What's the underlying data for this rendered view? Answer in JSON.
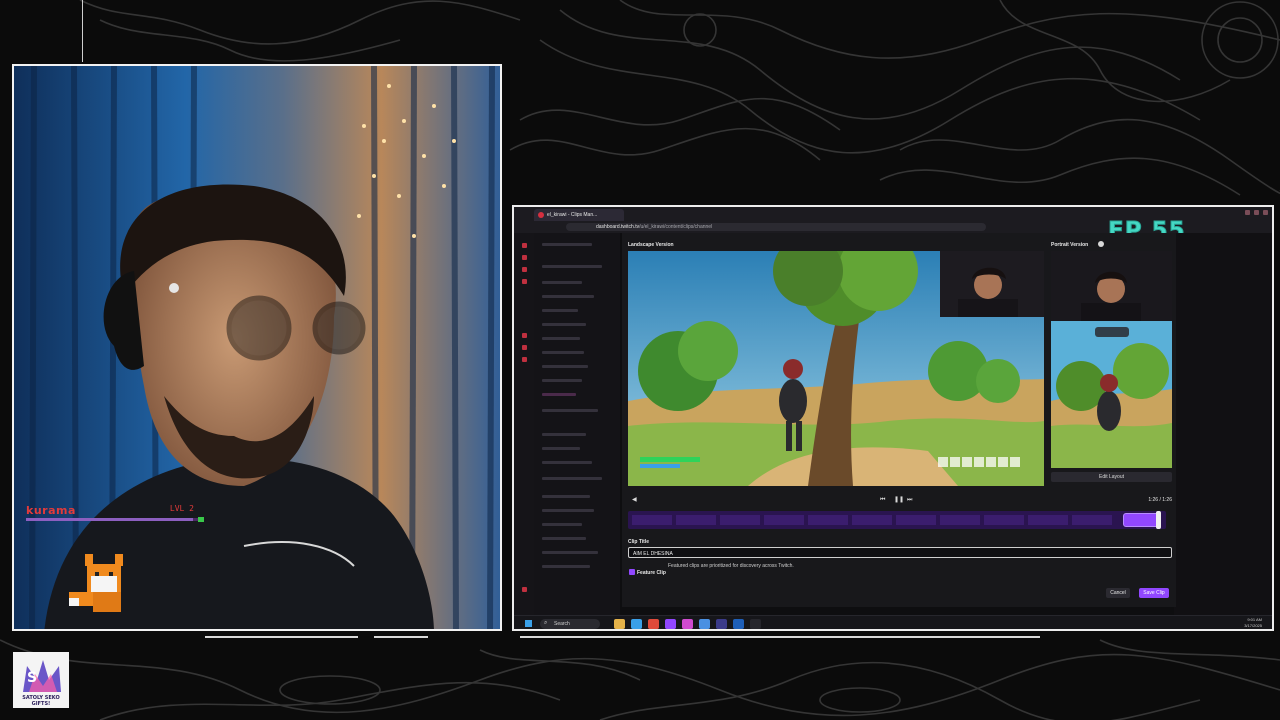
{
  "overlay": {
    "streamer_name": "kurama",
    "level_label": "LVL 2",
    "level_progress": 0.97,
    "episode_badge": "EP 55",
    "logo_text": "SATOLY SEKO GIFTS!"
  },
  "browser": {
    "tab_title": "el_kirawi - Clips Man...",
    "url_host": "dashboard.twitch.tv",
    "url_path": "/u/el_kirawi/content/clips/channel"
  },
  "clip_editor": {
    "landscape_label": "Landscape Version",
    "portrait_label": "Portrait Version",
    "edit_layout_label": "Edit Layout",
    "time_display": "1:26 / 1:26",
    "clip_title_label": "Clip Title",
    "clip_title_value": "AIM EL DHESINA",
    "feature_clip_label": "Feature Clip",
    "feature_clip_checked": true,
    "feature_description": "Featured clips are prioritized for discovery across Twitch.",
    "cancel_label": "Cancel",
    "save_label": "Save Clip",
    "timeline_selection": [
      0.92,
      0.99
    ]
  },
  "taskbar": {
    "search_placeholder": "Search",
    "clock_time": "9:01 AM",
    "clock_date": "3/17/2025"
  },
  "colors": {
    "accent": "#9147ff",
    "episode": "#45d8c4",
    "level_text": "#e23b3b"
  },
  "icons": [
    "mute-icon",
    "previous-icon",
    "pause-icon",
    "next-icon",
    "windows-start-icon",
    "search-icon",
    "checkbox-icon",
    "info-icon"
  ]
}
